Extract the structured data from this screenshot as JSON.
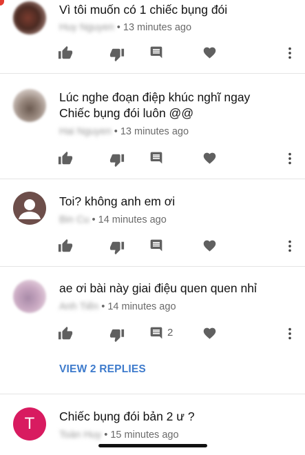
{
  "comments": [
    {
      "text": "Vì tôi muốn có 1 chiếc bụng đói",
      "author": "Huy Nguyen",
      "time": "• 13 minutes ago",
      "like_count": ""
    },
    {
      "text": "Lúc nghe đoạn điệp khúc nghĩ ngay Chiếc bụng đói luôn @@",
      "author": "Hai Nguyen",
      "time": "• 13 minutes ago",
      "like_count": ""
    },
    {
      "text": "Toi? không anh em ơi",
      "author": "Bin Cu",
      "time": "• 14 minutes ago",
      "like_count": ""
    },
    {
      "text": "ae ơi bài này giai điệu quen quen nhỉ",
      "author": "Anh Tiến",
      "time": "• 14 minutes ago",
      "reply_count": "2"
    },
    {
      "text": "Chiếc bụng đói bản 2 ư ?",
      "author": "Toàn Huy",
      "time": "• 15 minutes ago",
      "avatar_letter": "T"
    }
  ],
  "view_replies_label": "VIEW 2 REPLIES",
  "icons": {
    "like": "thumb-up-icon",
    "dislike": "thumb-down-icon",
    "reply": "comment-icon",
    "heart": "heart-icon",
    "more": "more-vertical-icon"
  },
  "colors": {
    "accent_link": "#3e7bcc",
    "icon_gray": "#606060",
    "avatar_t": "#d81b60",
    "avatar_default": "#6d4e4a"
  }
}
